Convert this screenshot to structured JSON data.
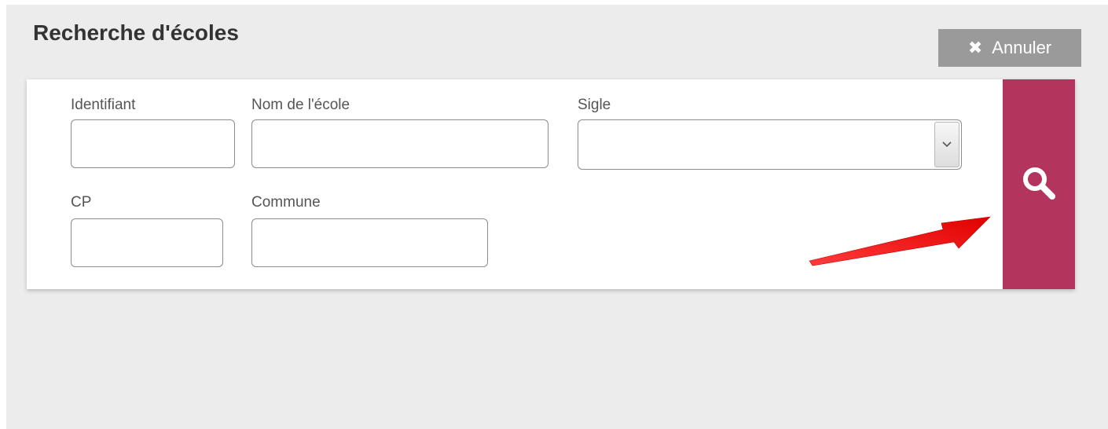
{
  "header": {
    "title": "Recherche d'écoles",
    "cancel_label": "Annuler"
  },
  "form": {
    "identifiant": {
      "label": "Identifiant",
      "value": ""
    },
    "nom": {
      "label": "Nom de l'école",
      "value": ""
    },
    "sigle": {
      "label": "Sigle",
      "selected": ""
    },
    "cp": {
      "label": "CP",
      "value": ""
    },
    "commune": {
      "label": "Commune",
      "value": ""
    }
  },
  "colors": {
    "accent": "#b3355e",
    "cancel_bg": "#9a9a9a",
    "panel_bg": "#ececec",
    "annotation_arrow": "#ff1a1a"
  },
  "icons": {
    "cancel": "close-icon",
    "search": "search-icon",
    "select": "chevron-down-icon",
    "annotation": "red-arrow-annotation"
  }
}
